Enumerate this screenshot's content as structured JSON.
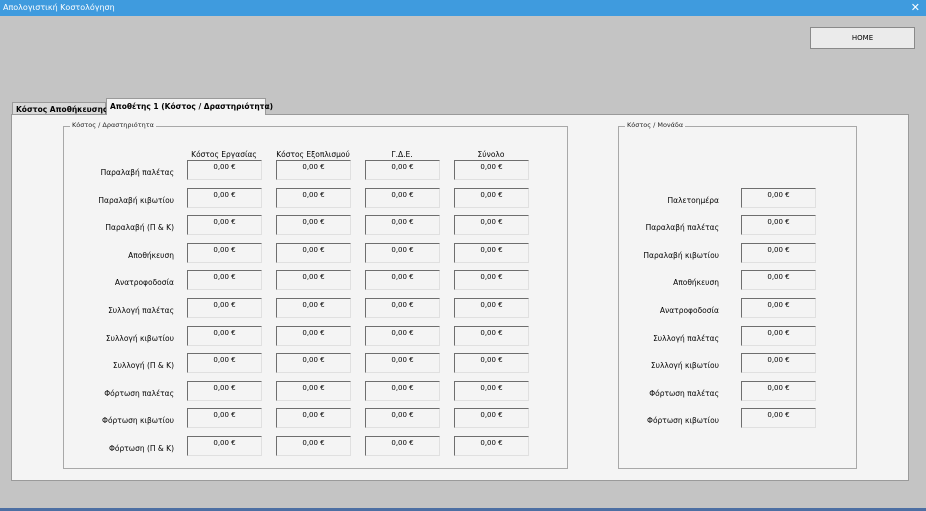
{
  "window": {
    "title": "Απολογιστική Κοστολόγηση",
    "close_glyph": "✕"
  },
  "home_button": "HOME",
  "tabs": [
    {
      "label": "Κόστος Αποθήκευσης",
      "active": false
    },
    {
      "label": "Αποθέτης 1 (Κόστος / Δραστηριότητα)",
      "active": true
    }
  ],
  "activity_group": {
    "caption": "Κόστος / Δραστηριότητα",
    "columns": [
      "Κόστος Εργασίας",
      "Κόστος Εξοπλισμού",
      "Γ.Δ.Ε.",
      "Σύνολο"
    ],
    "rows": [
      {
        "label": "Παραλαβή παλέτας",
        "values": [
          "0,00 €",
          "0,00 €",
          "0,00 €",
          "0,00 €"
        ]
      },
      {
        "label": "Παραλαβή κιβωτίου",
        "values": [
          "0,00 €",
          "0,00 €",
          "0,00 €",
          "0,00 €"
        ]
      },
      {
        "label": "Παραλαβή (Π & Κ)",
        "values": [
          "0,00 €",
          "0,00 €",
          "0,00 €",
          "0,00 €"
        ]
      },
      {
        "label": "Αποθήκευση",
        "values": [
          "0,00 €",
          "0,00 €",
          "0,00 €",
          "0,00 €"
        ]
      },
      {
        "label": "Ανατροφοδοσία",
        "values": [
          "0,00 €",
          "0,00 €",
          "0,00 €",
          "0,00 €"
        ]
      },
      {
        "label": "Συλλογή παλέτας",
        "values": [
          "0,00 €",
          "0,00 €",
          "0,00 €",
          "0,00 €"
        ]
      },
      {
        "label": "Συλλογή κιβωτίου",
        "values": [
          "0,00 €",
          "0,00 €",
          "0,00 €",
          "0,00 €"
        ]
      },
      {
        "label": "Συλλογή (Π & Κ)",
        "values": [
          "0,00 €",
          "0,00 €",
          "0,00 €",
          "0,00 €"
        ]
      },
      {
        "label": "Φόρτωση παλέτας",
        "values": [
          "0,00 €",
          "0,00 €",
          "0,00 €",
          "0,00 €"
        ]
      },
      {
        "label": "Φόρτωση κιβωτίου",
        "values": [
          "0,00 €",
          "0,00 €",
          "0,00 €",
          "0,00 €"
        ]
      },
      {
        "label": "Φόρτωση (Π & Κ)",
        "values": [
          "0,00 €",
          "0,00 €",
          "0,00 €",
          "0,00 €"
        ]
      }
    ]
  },
  "unit_group": {
    "caption": "Κόστος / Μονάδα",
    "rows": [
      {
        "label": "Παλετοημέρα",
        "value": "0,00 €"
      },
      {
        "label": "Παραλαβή παλέτας",
        "value": "0,00 €"
      },
      {
        "label": "Παραλαβή κιβωτίου",
        "value": "0,00 €"
      },
      {
        "label": "Αποθήκευση",
        "value": "0,00 €"
      },
      {
        "label": "Ανατροφοδοσία",
        "value": "0,00 €"
      },
      {
        "label": "Συλλογή παλέτας",
        "value": "0,00 €"
      },
      {
        "label": "Συλλογή κιβωτίου",
        "value": "0,00 €"
      },
      {
        "label": "Φόρτωση παλέτας",
        "value": "0,00 €"
      },
      {
        "label": "Φόρτωση κιβωτίου",
        "value": "0,00 €"
      }
    ]
  }
}
